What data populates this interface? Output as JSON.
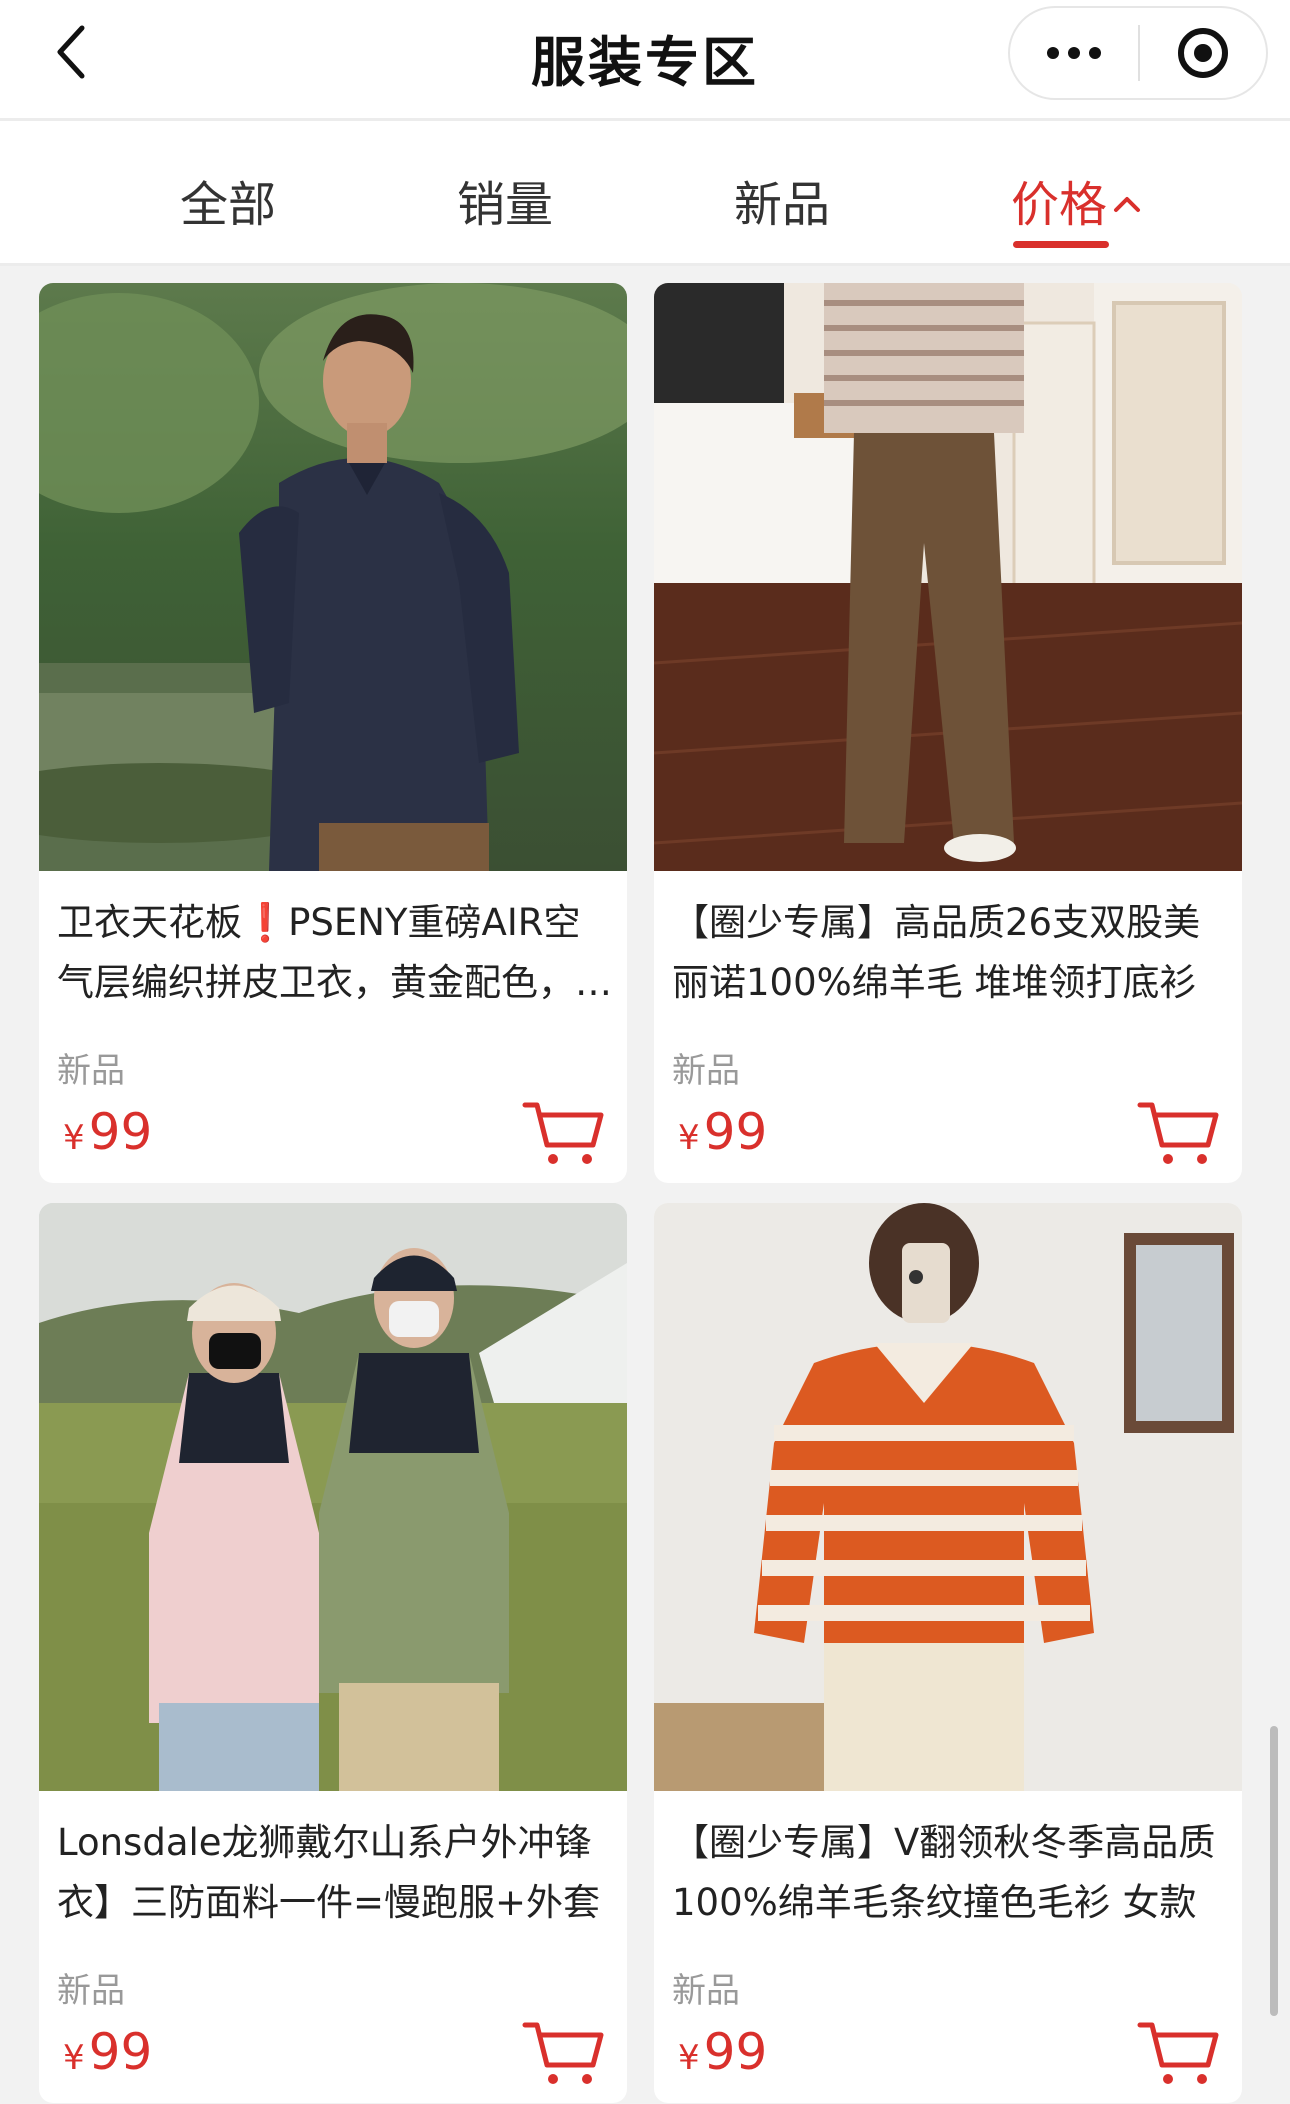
{
  "nav": {
    "title": "服装专区",
    "back_icon": "chevron-left-icon",
    "more_icon": "more-dots-icon",
    "close_icon": "target-close-icon"
  },
  "tabs": [
    {
      "label": "全部",
      "active": false
    },
    {
      "label": "销量",
      "active": false
    },
    {
      "label": "新品",
      "active": false
    },
    {
      "label": "价格",
      "active": true,
      "sort": "ascending"
    }
  ],
  "theme": {
    "accent": "#d9302c",
    "muted": "#999999"
  },
  "products": [
    {
      "title": "卫衣天花板❗️PSENY重磅AIR空气层编织拼皮卫衣，黄金配色，冬季保暖",
      "tag": "新品",
      "currency": "¥",
      "price": "99",
      "image": "man-navy-sweatshirt-forest-photo"
    },
    {
      "title": "【圈少专属】高品质26支双股美丽诺100%绵羊毛 堆堆领打底衫",
      "tag": "新品",
      "currency": "¥",
      "price": "99",
      "image": "striped-top-brown-trousers-photo"
    },
    {
      "title": "Lonsdale龙狮戴尔山系户外冲锋衣】三防面料一件=慢跑服+外套",
      "tag": "新品",
      "currency": "¥",
      "price": "99",
      "image": "couple-outdoor-jackets-photo"
    },
    {
      "title": "【圈少专属】V翻领秋冬季高品质100%绵羊毛条纹撞色毛衫 女款",
      "tag": "新品",
      "currency": "¥",
      "price": "99",
      "image": "orange-striped-sweater-photo"
    }
  ]
}
